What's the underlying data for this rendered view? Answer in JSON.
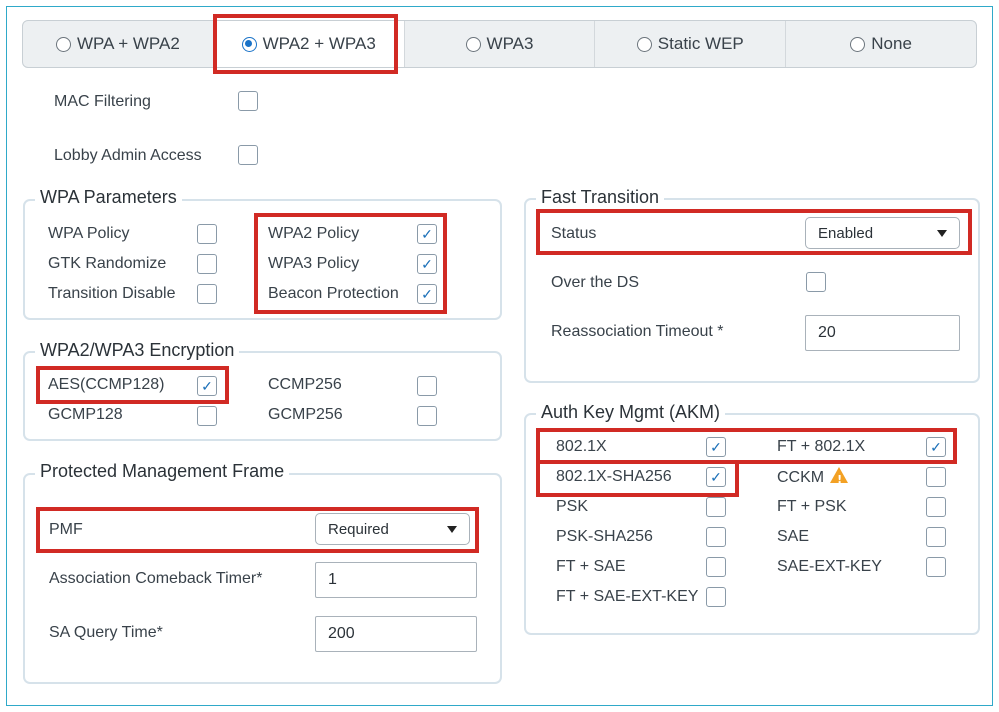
{
  "security_modes": {
    "options": [
      {
        "label": "WPA + WPA2",
        "selected": false
      },
      {
        "label": "WPA2 + WPA3",
        "selected": true
      },
      {
        "label": "WPA3",
        "selected": false
      },
      {
        "label": "Static WEP",
        "selected": false
      },
      {
        "label": "None",
        "selected": false
      }
    ]
  },
  "top_options": {
    "mac_filtering": {
      "label": "MAC Filtering",
      "checked": false
    },
    "lobby_admin_access": {
      "label": "Lobby Admin Access",
      "checked": false
    }
  },
  "wpa_parameters": {
    "title": "WPA Parameters",
    "items": [
      {
        "label": "WPA Policy",
        "checked": false
      },
      {
        "label": "GTK Randomize",
        "checked": false
      },
      {
        "label": "Transition Disable",
        "checked": false
      },
      {
        "label": "WPA2 Policy",
        "checked": true
      },
      {
        "label": "WPA3 Policy",
        "checked": true
      },
      {
        "label": "Beacon Protection",
        "checked": true
      }
    ]
  },
  "encryption": {
    "title": "WPA2/WPA3 Encryption",
    "items": [
      {
        "label": "AES(CCMP128)",
        "checked": true
      },
      {
        "label": "GCMP128",
        "checked": false
      },
      {
        "label": "CCMP256",
        "checked": false
      },
      {
        "label": "GCMP256",
        "checked": false
      }
    ]
  },
  "pmf": {
    "title": "Protected Management Frame",
    "pmf_label": "PMF",
    "pmf_value": "Required",
    "comeback_label": "Association Comeback Timer*",
    "comeback_value": "1",
    "sa_query_label": "SA Query Time*",
    "sa_query_value": "200"
  },
  "fast_transition": {
    "title": "Fast Transition",
    "status_label": "Status",
    "status_value": "Enabled",
    "over_ds_label": "Over the DS",
    "over_ds_checked": false,
    "reassoc_label": "Reassociation Timeout *",
    "reassoc_value": "20"
  },
  "akm": {
    "title": "Auth Key Mgmt (AKM)",
    "items": [
      {
        "label": "802.1X",
        "checked": true
      },
      {
        "label": "802.1X-SHA256",
        "checked": true
      },
      {
        "label": "PSK",
        "checked": false
      },
      {
        "label": "PSK-SHA256",
        "checked": false
      },
      {
        "label": "FT + SAE",
        "checked": false
      },
      {
        "label": "FT + SAE-EXT-KEY",
        "checked": false
      },
      {
        "label": "FT + 802.1X",
        "checked": true
      },
      {
        "label": "CCKM",
        "checked": false,
        "icon": "warning-icon"
      },
      {
        "label": "FT + PSK",
        "checked": false
      },
      {
        "label": "SAE",
        "checked": false
      },
      {
        "label": "SAE-EXT-KEY",
        "checked": false
      }
    ]
  },
  "colors": {
    "accent_blue": "#1a73c8",
    "highlight_red": "#d12a24",
    "frame_border": "#2fa9c9",
    "warning_orange": "#f3a124"
  }
}
